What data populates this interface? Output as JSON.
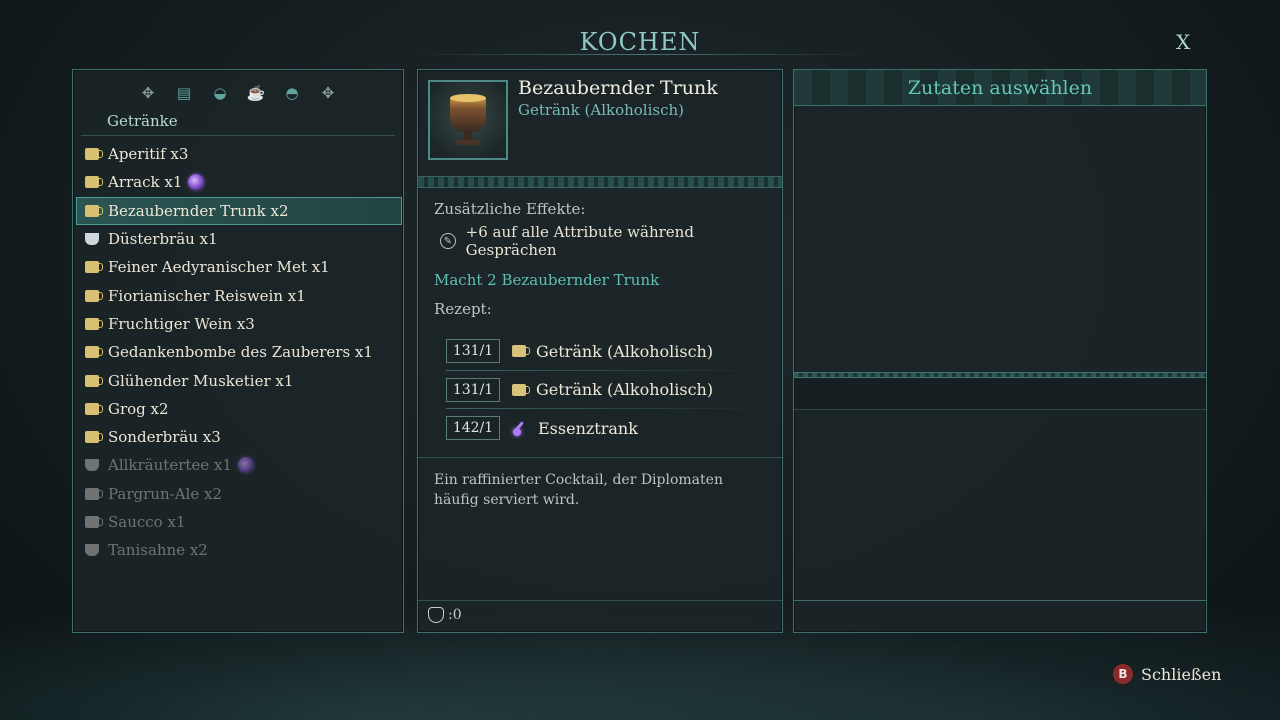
{
  "screen_title": "KOCHEN",
  "close_glyph": "X",
  "categories": {
    "icons": [
      "dpad-left-icon",
      "scroll-icon",
      "food-icon",
      "drink-icon",
      "bowl-icon",
      "dpad-right-icon"
    ],
    "selected_label": "Getränke"
  },
  "recipes": [
    {
      "label": "Aperitif x3",
      "icon": "mug-icon",
      "special": false,
      "disabled": false
    },
    {
      "label": "Arrack x1",
      "icon": "mug-icon",
      "special": true,
      "disabled": false
    },
    {
      "label": "Bezaubernder Trunk x2",
      "icon": "mug-icon",
      "special": false,
      "disabled": false,
      "selected": true
    },
    {
      "label": "Düsterbräu x1",
      "icon": "cup-icon",
      "special": false,
      "disabled": false
    },
    {
      "label": "Feiner Aedyranischer Met x1",
      "icon": "mug-icon",
      "special": false,
      "disabled": false
    },
    {
      "label": "Fiorianischer Reiswein x1",
      "icon": "mug-icon",
      "special": false,
      "disabled": false
    },
    {
      "label": "Fruchtiger Wein x3",
      "icon": "mug-icon",
      "special": false,
      "disabled": false
    },
    {
      "label": "Gedankenbombe des Zauberers x1",
      "icon": "mug-icon",
      "special": false,
      "disabled": false
    },
    {
      "label": "Glühender Musketier x1",
      "icon": "mug-icon",
      "special": false,
      "disabled": false
    },
    {
      "label": "Grog x2",
      "icon": "mug-icon",
      "special": false,
      "disabled": false
    },
    {
      "label": "Sonderbräu x3",
      "icon": "mug-icon",
      "special": false,
      "disabled": false
    },
    {
      "label": "Allkräutertee x1",
      "icon": "cup-icon",
      "special": true,
      "disabled": true
    },
    {
      "label": "Pargrun-Ale x2",
      "icon": "mug-icon",
      "special": false,
      "disabled": true
    },
    {
      "label": "Saucco x1",
      "icon": "mug-icon",
      "special": false,
      "disabled": true
    },
    {
      "label": "Tanisahne x2",
      "icon": "cup-icon",
      "special": false,
      "disabled": true
    }
  ],
  "detail": {
    "name": "Bezaubernder Trunk",
    "type": "Getränk (Alkoholisch)",
    "effects_label": "Zusätzliche Effekte:",
    "effect": "+6 auf alle Attribute während Gesprächen",
    "makes": "Macht 2 Bezaubernder Trunk",
    "recipe_label": "Rezept:",
    "ingredients": [
      {
        "qty": "131/1",
        "name": "Getränk (Alkoholisch)",
        "icon": "mug-icon"
      },
      {
        "qty": "131/1",
        "name": "Getränk (Alkoholisch)",
        "icon": "mug-icon"
      },
      {
        "qty": "142/1",
        "name": "Essenztrank",
        "icon": "vial-icon"
      }
    ],
    "description": "Ein raffinierter Cocktail, der Diplomaten häufig serviert wird.",
    "footer_value": ":0"
  },
  "ingredients_panel": {
    "title": "Zutaten auswählen"
  },
  "prompt": {
    "button": "B",
    "label": "Schließen"
  },
  "colors": {
    "accent": "#64c7b9",
    "border": "#3d6f6c",
    "selected_row": "#2a5552",
    "disabled_text": "#6c7474",
    "close_button": "#8a2a2a"
  }
}
